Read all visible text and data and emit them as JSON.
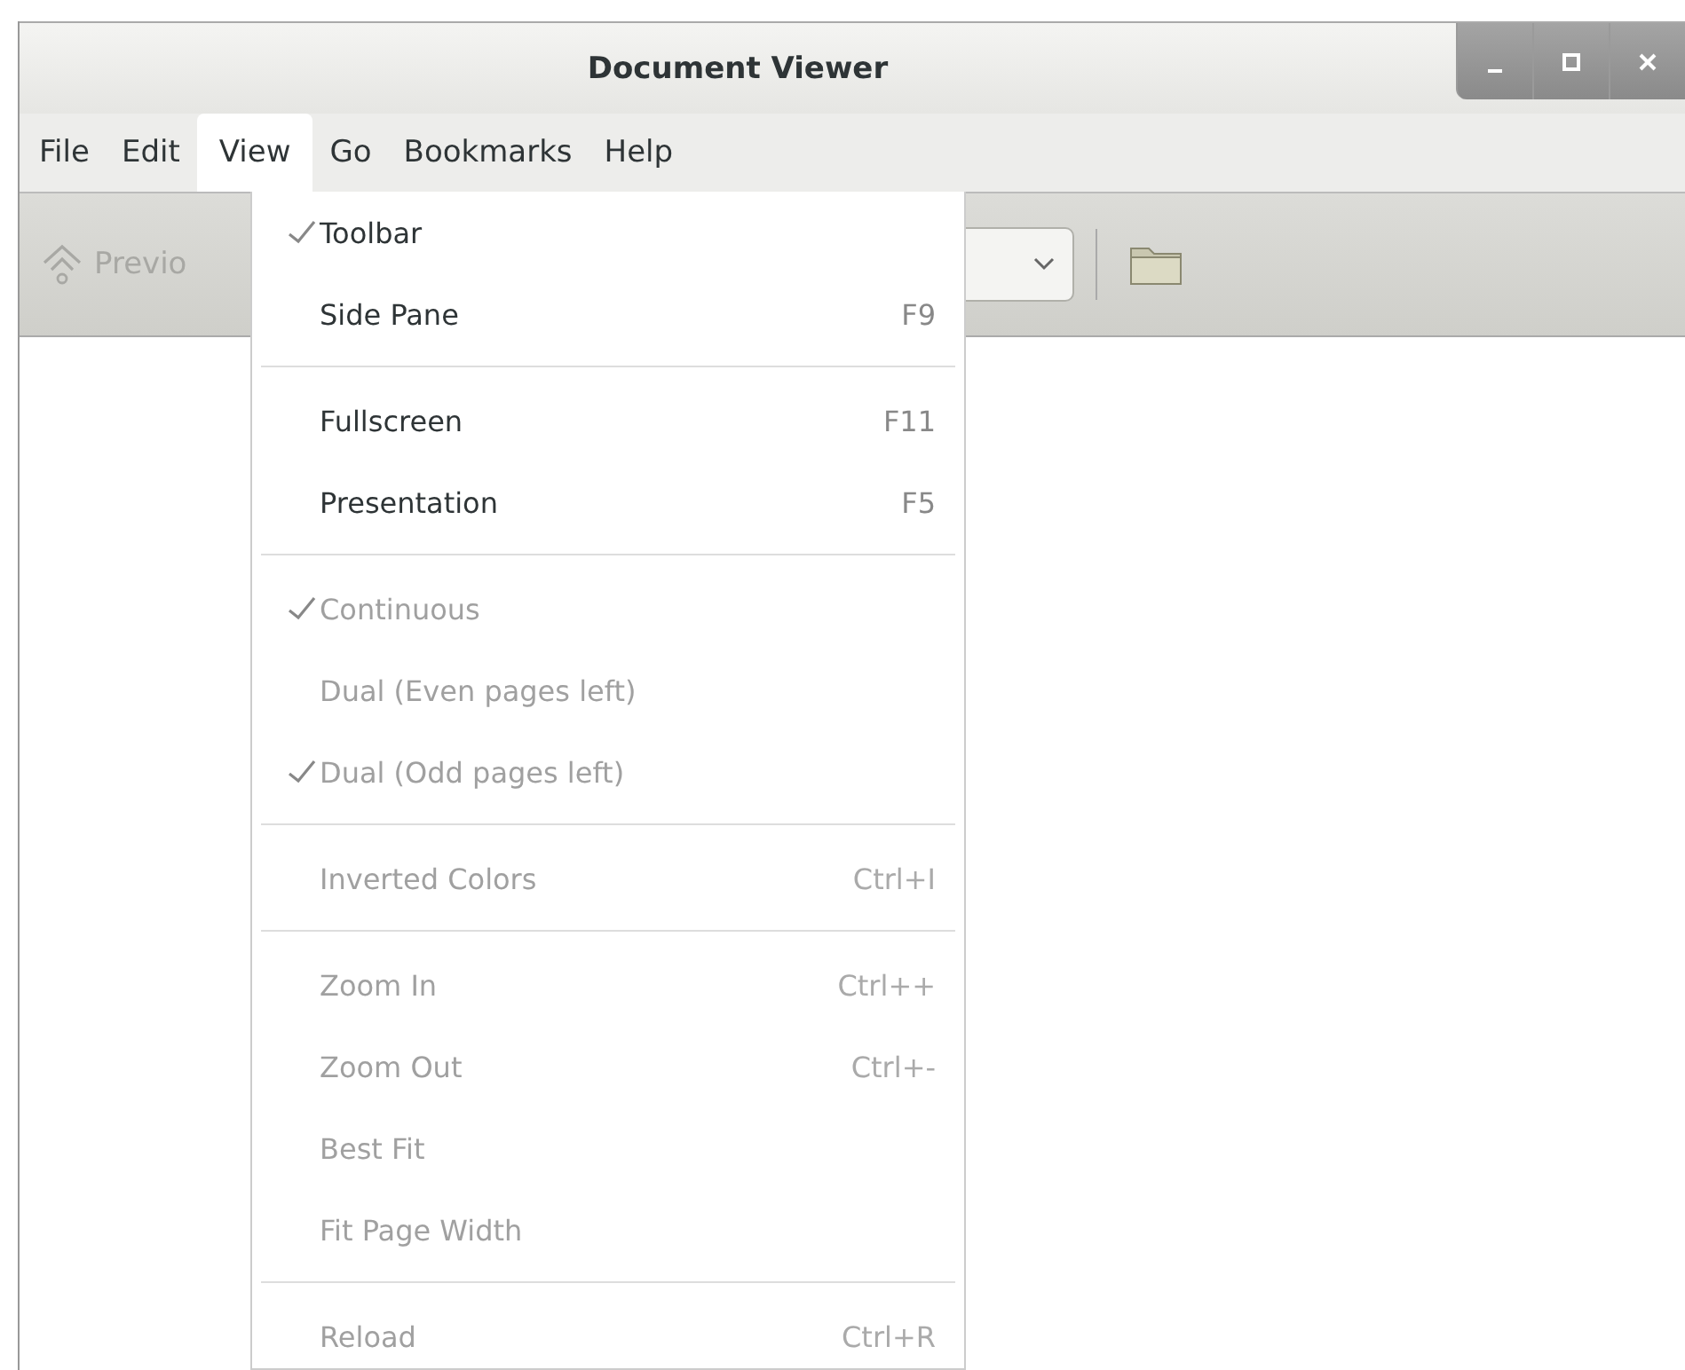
{
  "window": {
    "title": "Document Viewer"
  },
  "menubar": [
    {
      "label": "File",
      "selected": false
    },
    {
      "label": "Edit",
      "selected": false
    },
    {
      "label": "View",
      "selected": true
    },
    {
      "label": "Go",
      "selected": false
    },
    {
      "label": "Bookmarks",
      "selected": false
    },
    {
      "label": "Help",
      "selected": false
    }
  ],
  "toolbar": {
    "previous": {
      "label": "Previo",
      "disabled": true
    }
  },
  "menu": [
    {
      "kind": "item",
      "label": "Toolbar",
      "checked": true,
      "disabled": false
    },
    {
      "kind": "item",
      "label": "Side Pane",
      "shortcut": "F9",
      "checked": false,
      "disabled": false
    },
    {
      "kind": "separator"
    },
    {
      "kind": "item",
      "label": "Fullscreen",
      "shortcut": "F11",
      "checked": false,
      "disabled": false
    },
    {
      "kind": "item",
      "label": "Presentation",
      "shortcut": "F5",
      "checked": false,
      "disabled": false
    },
    {
      "kind": "separator"
    },
    {
      "kind": "item",
      "label": "Continuous",
      "checked": true,
      "disabled": true
    },
    {
      "kind": "item",
      "label": "Dual (Even pages left)",
      "checked": false,
      "disabled": true
    },
    {
      "kind": "item",
      "label": "Dual (Odd pages left)",
      "checked": true,
      "disabled": true
    },
    {
      "kind": "separator"
    },
    {
      "kind": "item",
      "label": "Inverted Colors",
      "shortcut": "Ctrl+I",
      "checked": false,
      "disabled": true
    },
    {
      "kind": "separator"
    },
    {
      "kind": "item",
      "label": "Zoom In",
      "shortcut": "Ctrl++",
      "checked": false,
      "disabled": true
    },
    {
      "kind": "item",
      "label": "Zoom Out",
      "shortcut": "Ctrl+-",
      "checked": false,
      "disabled": true
    },
    {
      "kind": "item",
      "label": "Best Fit",
      "checked": false,
      "disabled": true
    },
    {
      "kind": "item",
      "label": "Fit Page Width",
      "checked": false,
      "disabled": true
    },
    {
      "kind": "separator"
    },
    {
      "kind": "item",
      "label": "Reload",
      "shortcut": "Ctrl+R",
      "checked": false,
      "disabled": true
    }
  ]
}
